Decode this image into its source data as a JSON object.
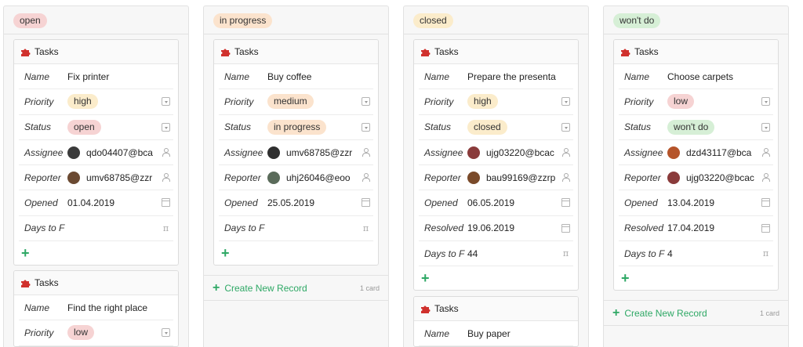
{
  "columns": [
    {
      "status": "open",
      "badge_color": "#f6d3d3",
      "cards": [
        {
          "title": "Tasks",
          "rows": [
            {
              "label": "Name",
              "value": "Fix printer",
              "kind": "text",
              "icon": ""
            },
            {
              "label": "Priority",
              "value": "high",
              "kind": "badge",
              "badge_color": "#fbeccb",
              "icon": "select-icon"
            },
            {
              "label": "Status",
              "value": "open",
              "kind": "badge",
              "badge_color": "#f6d3d3",
              "icon": "select-icon"
            },
            {
              "label": "Assignee",
              "value": "qdo04407@bca",
              "kind": "user",
              "avatar_color": "#3b3b3b",
              "icon": "user-icon"
            },
            {
              "label": "Reporter",
              "value": "umv68785@zzr",
              "kind": "user",
              "avatar_color": "#6b4a32",
              "icon": "user-icon"
            },
            {
              "label": "Opened",
              "value": "01.04.2019",
              "kind": "text",
              "icon": "calendar-icon"
            },
            {
              "label": "Days to F",
              "value": "",
              "kind": "text",
              "icon": "pi-icon"
            }
          ]
        },
        {
          "title": "Tasks",
          "rows": [
            {
              "label": "Name",
              "value": "Find the right place",
              "kind": "text",
              "icon": ""
            },
            {
              "label": "Priority",
              "value": "low",
              "kind": "badge",
              "badge_color": "#f6d3d3",
              "icon": "select-icon"
            }
          ]
        }
      ]
    },
    {
      "status": "in progress",
      "badge_color": "#fbe3cd",
      "cards": [
        {
          "title": "Tasks",
          "rows": [
            {
              "label": "Name",
              "value": "Buy coffee",
              "kind": "text",
              "icon": ""
            },
            {
              "label": "Priority",
              "value": "medium",
              "kind": "badge",
              "badge_color": "#fbe3cd",
              "icon": "select-icon"
            },
            {
              "label": "Status",
              "value": "in progress",
              "kind": "badge",
              "badge_color": "#fbe3cd",
              "icon": "select-icon"
            },
            {
              "label": "Assignee",
              "value": "umv68785@zzr",
              "kind": "user",
              "avatar_color": "#2f2f2f",
              "icon": "user-icon"
            },
            {
              "label": "Reporter",
              "value": "uhj26046@eoo",
              "kind": "user",
              "avatar_color": "#5a6b5a",
              "icon": "user-icon"
            },
            {
              "label": "Opened",
              "value": "25.05.2019",
              "kind": "text",
              "icon": "calendar-icon"
            },
            {
              "label": "Days to F",
              "value": "",
              "kind": "text",
              "icon": "pi-icon"
            }
          ]
        }
      ],
      "create_label": "Create New Record",
      "count_label": "1 card"
    },
    {
      "status": "closed",
      "badge_color": "#fbeccb",
      "cards": [
        {
          "title": "Tasks",
          "rows": [
            {
              "label": "Name",
              "value": "Prepare the presenta",
              "kind": "text",
              "icon": ""
            },
            {
              "label": "Priority",
              "value": "high",
              "kind": "badge",
              "badge_color": "#fbeccb",
              "icon": "select-icon"
            },
            {
              "label": "Status",
              "value": "closed",
              "kind": "badge",
              "badge_color": "#fbeccb",
              "icon": "select-icon"
            },
            {
              "label": "Assignee",
              "value": "ujg03220@bcac",
              "kind": "user",
              "avatar_color": "#8a3b3b",
              "icon": "user-icon"
            },
            {
              "label": "Reporter",
              "value": "bau99169@zzrp",
              "kind": "user",
              "avatar_color": "#7a4a2a",
              "icon": "user-icon"
            },
            {
              "label": "Opened",
              "value": "06.05.2019",
              "kind": "text",
              "icon": "calendar-icon"
            },
            {
              "label": "Resolved",
              "value": "19.06.2019",
              "kind": "text",
              "icon": "calendar-icon"
            },
            {
              "label": "Days to F",
              "value": "44",
              "kind": "text",
              "icon": "pi-icon"
            }
          ]
        },
        {
          "title": "Tasks",
          "rows": [
            {
              "label": "Name",
              "value": "Buy paper",
              "kind": "text",
              "icon": ""
            }
          ]
        }
      ]
    },
    {
      "status": "won't do",
      "badge_color": "#d6efd6",
      "cards": [
        {
          "title": "Tasks",
          "rows": [
            {
              "label": "Name",
              "value": "Choose carpets",
              "kind": "text",
              "icon": ""
            },
            {
              "label": "Priority",
              "value": "low",
              "kind": "badge",
              "badge_color": "#f6d3d3",
              "icon": "select-icon"
            },
            {
              "label": "Status",
              "value": "won't do",
              "kind": "badge",
              "badge_color": "#d6efd6",
              "icon": "select-icon"
            },
            {
              "label": "Assignee",
              "value": "dzd43117@bca",
              "kind": "user",
              "avatar_color": "#b5542a",
              "icon": "user-icon"
            },
            {
              "label": "Reporter",
              "value": "ujg03220@bcac",
              "kind": "user",
              "avatar_color": "#8a3b3b",
              "icon": "user-icon"
            },
            {
              "label": "Opened",
              "value": "13.04.2019",
              "kind": "text",
              "icon": "calendar-icon"
            },
            {
              "label": "Resolved",
              "value": "17.04.2019",
              "kind": "text",
              "icon": "calendar-icon"
            },
            {
              "label": "Days to F",
              "value": "4",
              "kind": "text",
              "icon": "pi-icon"
            }
          ]
        }
      ],
      "create_label": "Create New Record",
      "count_label": "1 card"
    }
  ]
}
